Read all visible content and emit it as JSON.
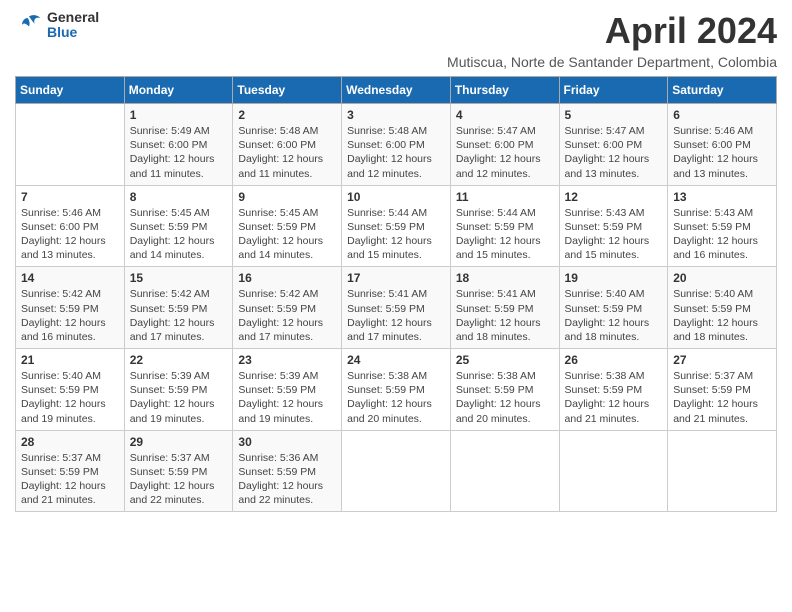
{
  "logo": {
    "line1": "General",
    "line2": "Blue"
  },
  "title": "April 2024",
  "subtitle": "Mutiscua, Norte de Santander Department, Colombia",
  "weekdays": [
    "Sunday",
    "Monday",
    "Tuesday",
    "Wednesday",
    "Thursday",
    "Friday",
    "Saturday"
  ],
  "weeks": [
    [
      null,
      {
        "day": "1",
        "sunrise": "5:49 AM",
        "sunset": "6:00 PM",
        "daylight": "12 hours and 11 minutes."
      },
      {
        "day": "2",
        "sunrise": "5:48 AM",
        "sunset": "6:00 PM",
        "daylight": "12 hours and 11 minutes."
      },
      {
        "day": "3",
        "sunrise": "5:48 AM",
        "sunset": "6:00 PM",
        "daylight": "12 hours and 12 minutes."
      },
      {
        "day": "4",
        "sunrise": "5:47 AM",
        "sunset": "6:00 PM",
        "daylight": "12 hours and 12 minutes."
      },
      {
        "day": "5",
        "sunrise": "5:47 AM",
        "sunset": "6:00 PM",
        "daylight": "12 hours and 13 minutes."
      },
      {
        "day": "6",
        "sunrise": "5:46 AM",
        "sunset": "6:00 PM",
        "daylight": "12 hours and 13 minutes."
      }
    ],
    [
      {
        "day": "7",
        "sunrise": "5:46 AM",
        "sunset": "6:00 PM",
        "daylight": "12 hours and 13 minutes."
      },
      {
        "day": "8",
        "sunrise": "5:45 AM",
        "sunset": "5:59 PM",
        "daylight": "12 hours and 14 minutes."
      },
      {
        "day": "9",
        "sunrise": "5:45 AM",
        "sunset": "5:59 PM",
        "daylight": "12 hours and 14 minutes."
      },
      {
        "day": "10",
        "sunrise": "5:44 AM",
        "sunset": "5:59 PM",
        "daylight": "12 hours and 15 minutes."
      },
      {
        "day": "11",
        "sunrise": "5:44 AM",
        "sunset": "5:59 PM",
        "daylight": "12 hours and 15 minutes."
      },
      {
        "day": "12",
        "sunrise": "5:43 AM",
        "sunset": "5:59 PM",
        "daylight": "12 hours and 15 minutes."
      },
      {
        "day": "13",
        "sunrise": "5:43 AM",
        "sunset": "5:59 PM",
        "daylight": "12 hours and 16 minutes."
      }
    ],
    [
      {
        "day": "14",
        "sunrise": "5:42 AM",
        "sunset": "5:59 PM",
        "daylight": "12 hours and 16 minutes."
      },
      {
        "day": "15",
        "sunrise": "5:42 AM",
        "sunset": "5:59 PM",
        "daylight": "12 hours and 17 minutes."
      },
      {
        "day": "16",
        "sunrise": "5:42 AM",
        "sunset": "5:59 PM",
        "daylight": "12 hours and 17 minutes."
      },
      {
        "day": "17",
        "sunrise": "5:41 AM",
        "sunset": "5:59 PM",
        "daylight": "12 hours and 17 minutes."
      },
      {
        "day": "18",
        "sunrise": "5:41 AM",
        "sunset": "5:59 PM",
        "daylight": "12 hours and 18 minutes."
      },
      {
        "day": "19",
        "sunrise": "5:40 AM",
        "sunset": "5:59 PM",
        "daylight": "12 hours and 18 minutes."
      },
      {
        "day": "20",
        "sunrise": "5:40 AM",
        "sunset": "5:59 PM",
        "daylight": "12 hours and 18 minutes."
      }
    ],
    [
      {
        "day": "21",
        "sunrise": "5:40 AM",
        "sunset": "5:59 PM",
        "daylight": "12 hours and 19 minutes."
      },
      {
        "day": "22",
        "sunrise": "5:39 AM",
        "sunset": "5:59 PM",
        "daylight": "12 hours and 19 minutes."
      },
      {
        "day": "23",
        "sunrise": "5:39 AM",
        "sunset": "5:59 PM",
        "daylight": "12 hours and 19 minutes."
      },
      {
        "day": "24",
        "sunrise": "5:38 AM",
        "sunset": "5:59 PM",
        "daylight": "12 hours and 20 minutes."
      },
      {
        "day": "25",
        "sunrise": "5:38 AM",
        "sunset": "5:59 PM",
        "daylight": "12 hours and 20 minutes."
      },
      {
        "day": "26",
        "sunrise": "5:38 AM",
        "sunset": "5:59 PM",
        "daylight": "12 hours and 21 minutes."
      },
      {
        "day": "27",
        "sunrise": "5:37 AM",
        "sunset": "5:59 PM",
        "daylight": "12 hours and 21 minutes."
      }
    ],
    [
      {
        "day": "28",
        "sunrise": "5:37 AM",
        "sunset": "5:59 PM",
        "daylight": "12 hours and 21 minutes."
      },
      {
        "day": "29",
        "sunrise": "5:37 AM",
        "sunset": "5:59 PM",
        "daylight": "12 hours and 22 minutes."
      },
      {
        "day": "30",
        "sunrise": "5:36 AM",
        "sunset": "5:59 PM",
        "daylight": "12 hours and 22 minutes."
      },
      null,
      null,
      null,
      null
    ]
  ]
}
